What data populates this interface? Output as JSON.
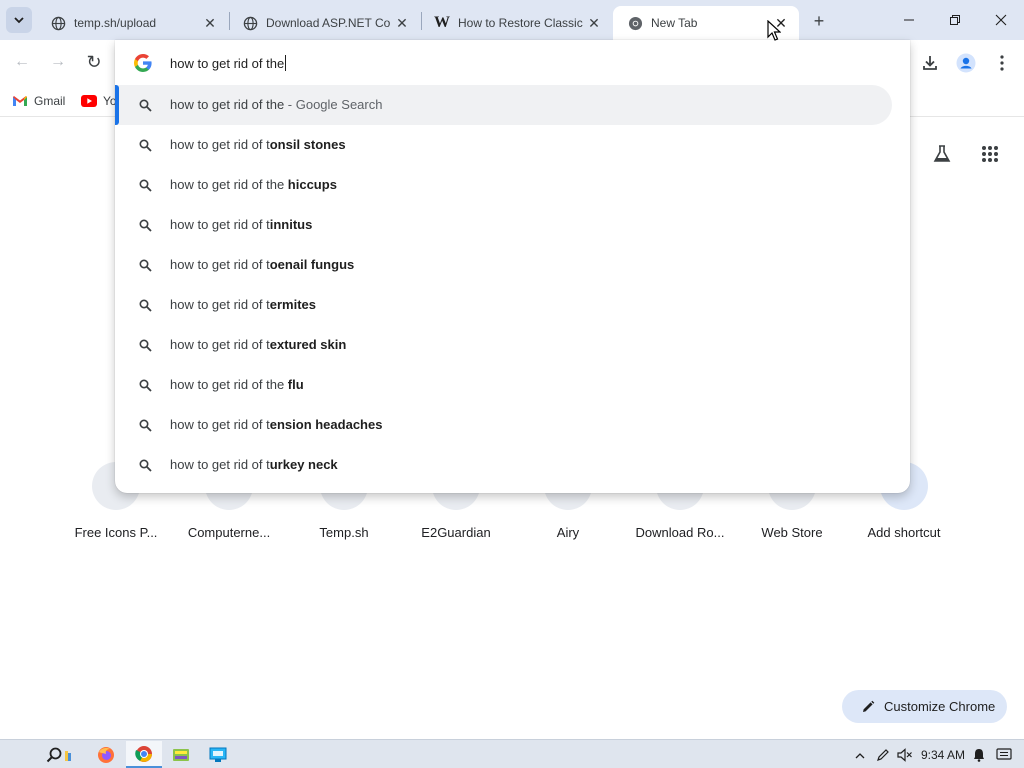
{
  "tabstrip": {
    "tabs": [
      {
        "title": "temp.sh/upload",
        "icon": "globe-icon"
      },
      {
        "title": "Download ASP.NET Co",
        "icon": "globe-icon"
      },
      {
        "title": "How to Restore Classic",
        "icon": "wikihow-w-icon"
      },
      {
        "title": "New Tab",
        "icon": "chrome-icon",
        "active": true
      }
    ],
    "close_glyph": "✕",
    "new_tab_glyph": "+",
    "window_controls": {
      "minimize": "—",
      "restore": "❐",
      "close": "✕"
    }
  },
  "toolbar": {
    "back": "←",
    "forward": "→",
    "reload": "↻"
  },
  "bookmarks": [
    {
      "label": "Gmail",
      "icon": "gmail-icon"
    },
    {
      "label": "Yo",
      "icon": "youtube-icon"
    }
  ],
  "omnibox": {
    "query": "how to get rid of the",
    "suggestions": [
      {
        "prefix": "how to get rid of the",
        "bold": "",
        "suffix": " - Google Search",
        "selected": true
      },
      {
        "prefix": "how to get rid of t",
        "bold": "onsil stones",
        "suffix": ""
      },
      {
        "prefix": "how to get rid of the ",
        "bold": "hiccups",
        "suffix": ""
      },
      {
        "prefix": "how to get rid of t",
        "bold": "innitus",
        "suffix": ""
      },
      {
        "prefix": "how to get rid of t",
        "bold": "oenail fungus",
        "suffix": ""
      },
      {
        "prefix": "how to get rid of t",
        "bold": "ermites",
        "suffix": ""
      },
      {
        "prefix": "how to get rid of t",
        "bold": "extured skin",
        "suffix": ""
      },
      {
        "prefix": "how to get rid of the ",
        "bold": "flu",
        "suffix": ""
      },
      {
        "prefix": "how to get rid of t",
        "bold": "ension headaches",
        "suffix": ""
      },
      {
        "prefix": "how to get rid of t",
        "bold": "urkey neck",
        "suffix": ""
      }
    ]
  },
  "shortcuts": [
    {
      "label": "Free Icons P..."
    },
    {
      "label": "Computerne..."
    },
    {
      "label": "Temp.sh"
    },
    {
      "label": "E2Guardian"
    },
    {
      "label": "Airy"
    },
    {
      "label": "Download Ro..."
    },
    {
      "label": "Web Store"
    },
    {
      "label": "Add shortcut"
    }
  ],
  "customize": {
    "label": "Customize Chrome"
  },
  "taskbar": {
    "clock": "9:34 AM"
  },
  "colors": {
    "accent": "#1a73e8",
    "tabstrip_bg": "#dfe6f3",
    "taskbar_bg": "#dfe5ee"
  }
}
